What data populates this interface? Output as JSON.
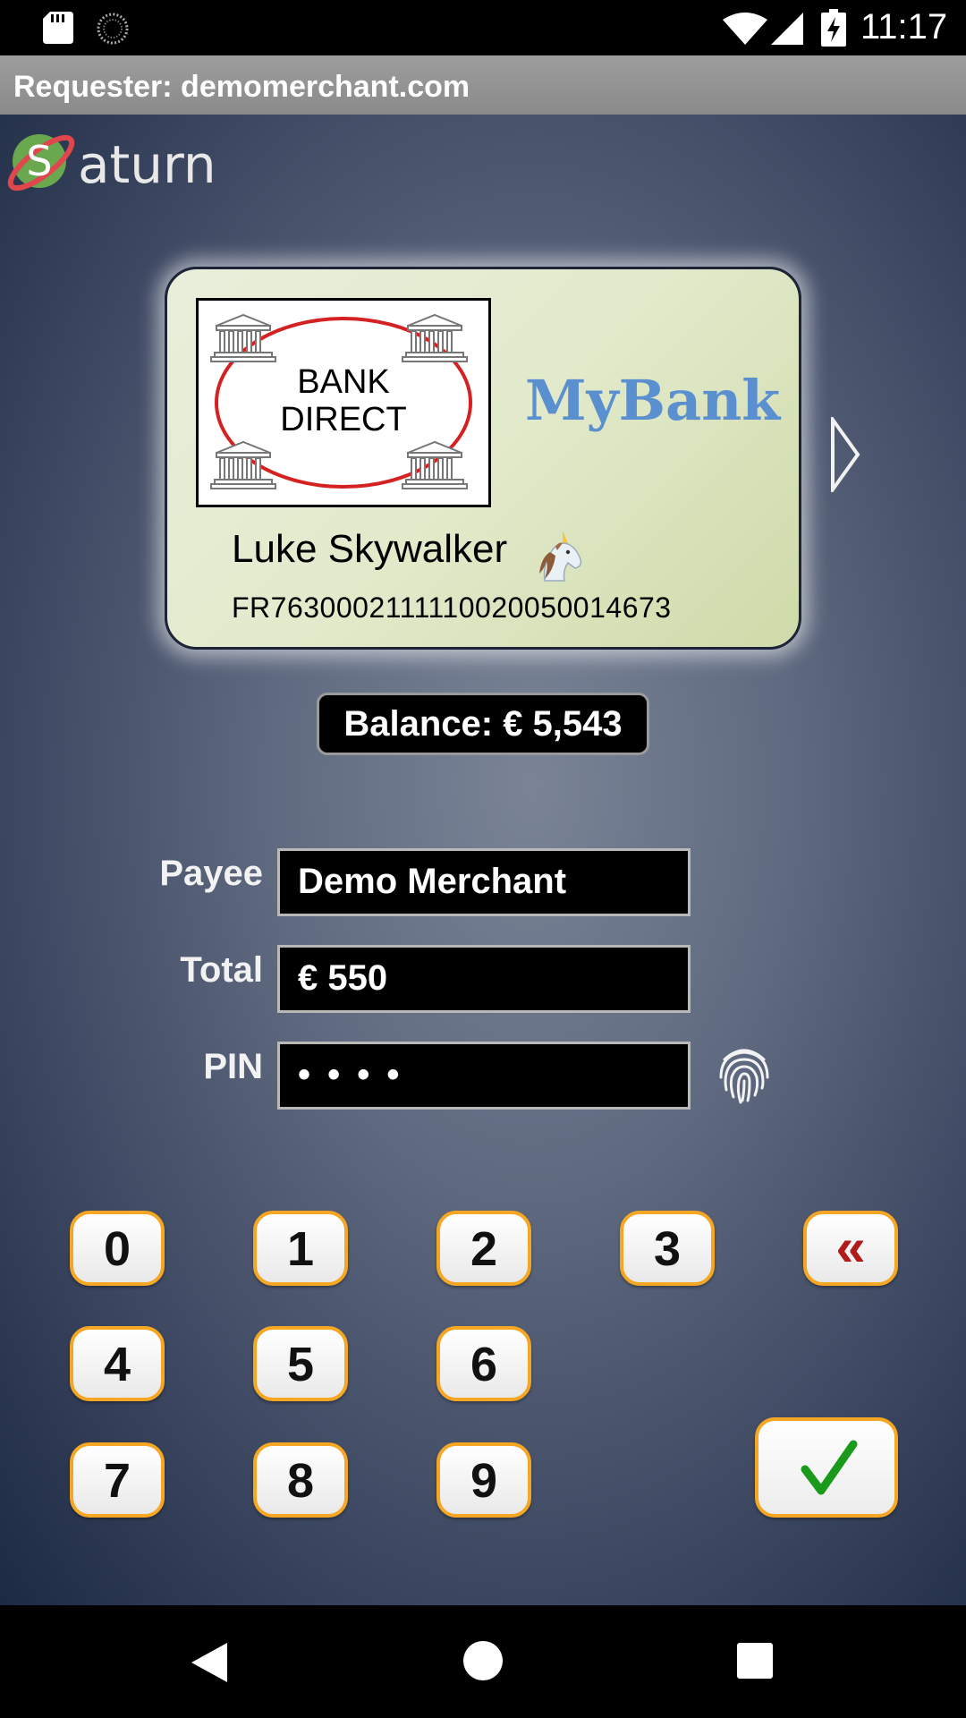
{
  "status_bar": {
    "time": "11:17",
    "icons": [
      "sd-card-icon",
      "loading-spinner-icon",
      "wifi-icon",
      "cell-signal-icon",
      "battery-charging-icon"
    ]
  },
  "requester": {
    "text": "Requester: demomerchant.com"
  },
  "app": {
    "logo_letter": "S",
    "logo_text": "aturn"
  },
  "card": {
    "bank_logo_line1": "BANK",
    "bank_logo_line2": "DIRECT",
    "brand": "MyBank",
    "holder_name": "Luke Skywalker",
    "holder_icon": "unicorn-icon",
    "iban": "FR7630002111110020050014673"
  },
  "balance": {
    "text": "Balance: € 5,543"
  },
  "form": {
    "payee_label": "Payee",
    "payee_value": "Demo Merchant",
    "total_label": "Total",
    "total_value": "€ 550",
    "pin_label": "PIN",
    "pin_value": "• • • •"
  },
  "keypad": {
    "keys": [
      "0",
      "1",
      "2",
      "3",
      "4",
      "5",
      "6",
      "7",
      "8",
      "9"
    ],
    "backspace_label": "«"
  },
  "colors": {
    "accent_orange": "#f5a623",
    "brand_blue": "#5a8fd0",
    "confirm_green": "#1a9a1a",
    "backspace_red": "#b01c1c"
  }
}
